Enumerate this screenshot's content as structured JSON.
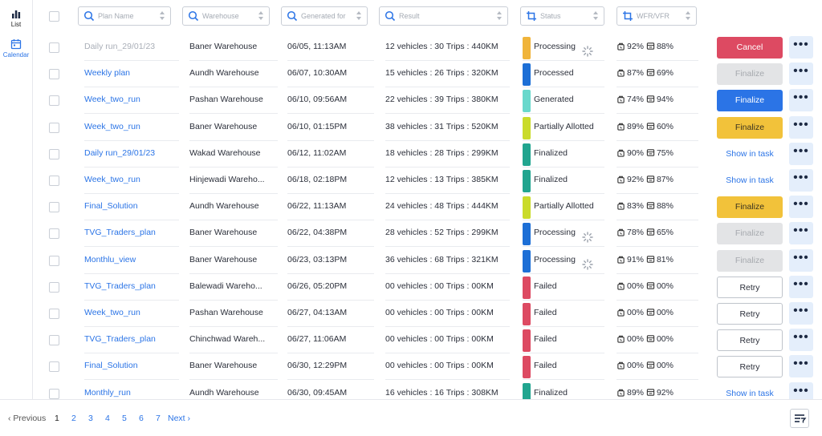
{
  "sidebar": {
    "list_label": "List",
    "calendar_label": "Calendar"
  },
  "filters": {
    "plan_name": "Plan Name",
    "warehouse": "Warehouse",
    "generated_for": "Generated for",
    "result": "Result",
    "status": "Status",
    "wfr_vfr": "WFR/VFR"
  },
  "rows": [
    {
      "plan": "Daily run_29/01/23",
      "plan_muted": true,
      "warehouse": "Baner Warehouse",
      "generated": "06/05, 11:13AM",
      "result": "12 vehicles : 30 Trips  : 440KM",
      "status": "Processing",
      "status_color": "#f0b43a",
      "spinner": true,
      "wfr": "92%",
      "vfr": "88%",
      "action": "Cancel",
      "action_style": "red"
    },
    {
      "plan": "Weekly plan",
      "plan_muted": false,
      "warehouse": "Aundh Warehouse",
      "generated": "06/07, 10:30AM",
      "result": "15 vehicles : 26 Trips  : 320KM",
      "status": "Processed",
      "status_color": "#1d6fd6",
      "spinner": false,
      "wfr": "87%",
      "vfr": "69%",
      "action": "Finalize",
      "action_style": "grey"
    },
    {
      "plan": "Week_two_run",
      "plan_muted": false,
      "warehouse": "Pashan Warehouse",
      "generated": "06/10, 09:56AM",
      "result": "22 vehicles : 39 Trips  : 380KM",
      "status": "Generated",
      "status_color": "#69d8cc",
      "spinner": false,
      "wfr": "74%",
      "vfr": "94%",
      "action": "Finalize",
      "action_style": "blue"
    },
    {
      "plan": "Week_two_run",
      "plan_muted": false,
      "warehouse": "Baner Warehouse",
      "generated": "06/10, 01:15PM",
      "result": "38 vehicles : 31 Trips  : 520KM",
      "status": "Partially Allotted",
      "status_color": "#cadb2a",
      "spinner": false,
      "wfr": "89%",
      "vfr": "60%",
      "action": "Finalize",
      "action_style": "yellow"
    },
    {
      "plan": "Daily run_29/01/23",
      "plan_muted": false,
      "warehouse": "Wakad Warehouse",
      "generated": "06/12, 11:02AM",
      "result": "18 vehicles : 28 Trips  : 299KM",
      "status": "Finalized",
      "status_color": "#21a58f",
      "spinner": false,
      "wfr": "90%",
      "vfr": "75%",
      "action": "Show in task",
      "action_style": "link"
    },
    {
      "plan": "Week_two_run",
      "plan_muted": false,
      "warehouse": "Hinjewadi Wareho...",
      "generated": "06/18, 02:18PM",
      "result": "12 vehicles : 13 Trips  : 385KM",
      "status": "Finalized",
      "status_color": "#21a58f",
      "spinner": false,
      "wfr": "92%",
      "vfr": "87%",
      "action": "Show in task",
      "action_style": "link"
    },
    {
      "plan": "Final_Solution",
      "plan_muted": false,
      "warehouse": "Aundh Warehouse",
      "generated": "06/22, 11:13AM",
      "result": "24 vehicles : 48 Trips  : 444KM",
      "status": "Partially Allotted",
      "status_color": "#cadb2a",
      "spinner": false,
      "wfr": "83%",
      "vfr": "88%",
      "action": "Finalize",
      "action_style": "yellow"
    },
    {
      "plan": "TVG_Traders_plan",
      "plan_muted": false,
      "warehouse": "Baner Warehouse",
      "generated": "06/22, 04:38PM",
      "result": "28 vehicles : 52 Trips  : 299KM",
      "status": "Processing",
      "status_color": "#1d6fd6",
      "spinner": true,
      "wfr": "78%",
      "vfr": "65%",
      "action": "Finalize",
      "action_style": "grey"
    },
    {
      "plan": "Monthlu_view",
      "plan_muted": false,
      "warehouse": "Baner Warehouse",
      "generated": "06/23, 03:13PM",
      "result": "36 vehicles : 68 Trips  : 321KM",
      "status": "Processing",
      "status_color": "#1d6fd6",
      "spinner": true,
      "wfr": "91%",
      "vfr": "81%",
      "action": "Finalize",
      "action_style": "grey"
    },
    {
      "plan": "TVG_Traders_plan",
      "plan_muted": false,
      "warehouse": "Balewadi Wareho...",
      "generated": "06/26, 05:20PM",
      "result": "00 vehicles : 00 Trips  : 00KM",
      "status": "Failed",
      "status_color": "#dd4a62",
      "spinner": false,
      "wfr": "00%",
      "vfr": "00%",
      "action": "Retry",
      "action_style": "outline"
    },
    {
      "plan": "Week_two_run",
      "plan_muted": false,
      "warehouse": "Pashan Warehouse",
      "generated": "06/27, 04:13AM",
      "result": "00 vehicles : 00 Trips  : 00KM",
      "status": "Failed",
      "status_color": "#dd4a62",
      "spinner": false,
      "wfr": "00%",
      "vfr": "00%",
      "action": "Retry",
      "action_style": "outline"
    },
    {
      "plan": "TVG_Traders_plan",
      "plan_muted": false,
      "warehouse": "Chinchwad Wareh...",
      "generated": "06/27, 11:06AM",
      "result": "00 vehicles : 00 Trips  : 00KM",
      "status": "Failed",
      "status_color": "#dd4a62",
      "spinner": false,
      "wfr": "00%",
      "vfr": "00%",
      "action": "Retry",
      "action_style": "outline"
    },
    {
      "plan": "Final_Solution",
      "plan_muted": false,
      "warehouse": "Baner Warehouse",
      "generated": "06/30, 12:29PM",
      "result": "00 vehicles : 00 Trips  : 00KM",
      "status": "Failed",
      "status_color": "#dd4a62",
      "spinner": false,
      "wfr": "00%",
      "vfr": "00%",
      "action": "Retry",
      "action_style": "outline"
    },
    {
      "plan": "Monthly_run",
      "plan_muted": false,
      "warehouse": "Aundh Warehouse",
      "generated": "06/30, 09:45AM",
      "result": "16 vehicles : 16 Trips  : 308KM",
      "status": "Finalized",
      "status_color": "#21a58f",
      "spinner": false,
      "wfr": "89%",
      "vfr": "92%",
      "action": "Show in task",
      "action_style": "link"
    }
  ],
  "more_label": "•••",
  "pagination": {
    "prev": "‹ Previous",
    "pages": [
      "1",
      "2",
      "3",
      "4",
      "5",
      "6",
      "7"
    ],
    "current": "1",
    "next": "Next ›"
  }
}
